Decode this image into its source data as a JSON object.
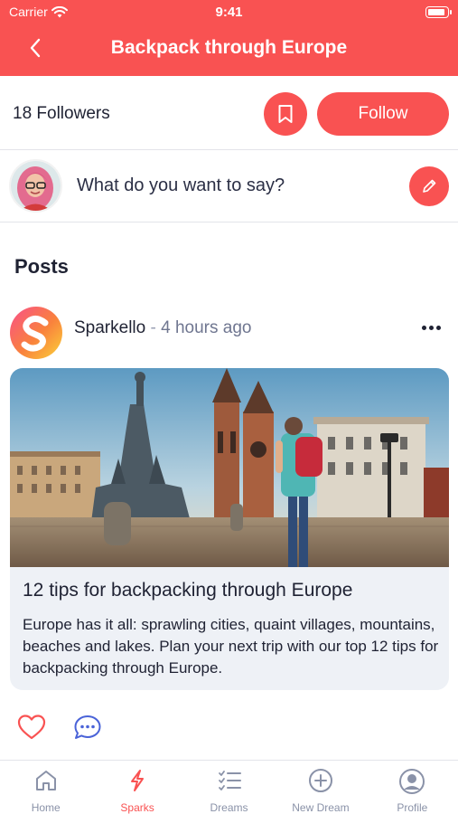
{
  "status_bar": {
    "carrier": "Carrier",
    "time": "9:41",
    "battery_fraction": 0.9
  },
  "nav": {
    "title": "Backpack through Europe",
    "back_icon": "chevron-left-icon"
  },
  "group": {
    "followers": "18 Followers",
    "follow_label": "Follow",
    "bookmark_icon": "bookmark-icon"
  },
  "compose": {
    "placeholder": "What do you want to say?",
    "edit_icon": "pencil-icon"
  },
  "posts_heading": "Posts",
  "post": {
    "author": "Sparkello",
    "separator": "-",
    "time": "4 hours ago",
    "card_title": "12 tips for backpacking through Europe",
    "card_desc": "Europe has it all: sprawling cities, quaint villages, mountains, beaches and lakes. Plan your next trip with our top 12 tips for backpacking through Europe."
  },
  "tabs": [
    {
      "label": "Home",
      "icon": "home-icon"
    },
    {
      "label": "Sparks",
      "icon": "lightning-icon",
      "active": true
    },
    {
      "label": "Dreams",
      "icon": "checklist-icon"
    },
    {
      "label": "New Dream",
      "icon": "plus-circle-icon"
    },
    {
      "label": "Profile",
      "icon": "person-circle-icon"
    }
  ],
  "colors": {
    "accent": "#f95252",
    "muted": "#8a92a8",
    "comment": "#4a63d8"
  }
}
